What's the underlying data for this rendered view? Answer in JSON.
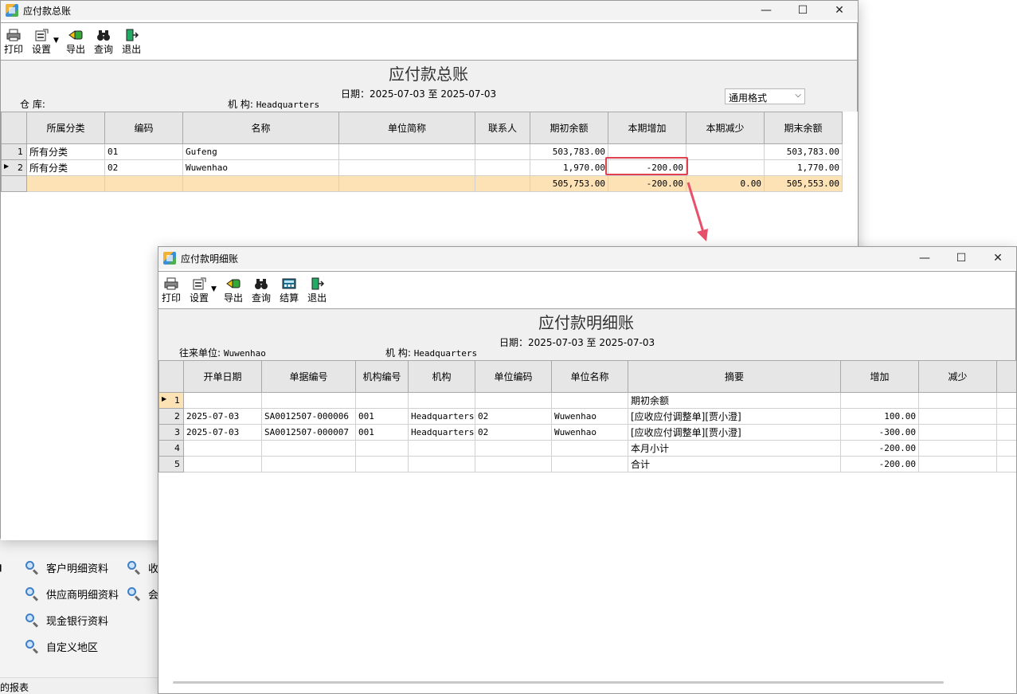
{
  "bg_links": [
    {
      "label": "客户明细资料"
    },
    {
      "label": "供应商明细资料"
    },
    {
      "label": "现金银行资料"
    },
    {
      "label": "自定义地区"
    }
  ],
  "bg_partial": [
    "收",
    "会"
  ],
  "bg_left_partial": "的报表",
  "win1": {
    "title": "应付款总账",
    "toolbar": {
      "print": "打印",
      "settings": "设置",
      "export": "导出",
      "query": "查询",
      "exit": "退出"
    },
    "report_title": "应付款总账",
    "date_label": "日期：2025-07-03  至  2025-07-03",
    "warehouse_label": "仓    库:",
    "org_label": "机    构:",
    "org_value": "Headquarters",
    "format_select": "通用格式",
    "columns": [
      "所属分类",
      "编码",
      "名称",
      "单位简称",
      "联系人",
      "期初余额",
      "本期增加",
      "本期减少",
      "期末余额"
    ],
    "rows": [
      {
        "no": "1",
        "cells": [
          "所有分类",
          "01",
          "Gufeng",
          "",
          "",
          "503,783.00",
          "",
          "",
          "503,783.00"
        ]
      },
      {
        "no": "2",
        "cells": [
          "所有分类",
          "02",
          "Wuwenhao",
          "",
          "",
          "1,970.00",
          "-200.00",
          "",
          "1,770.00"
        ]
      }
    ],
    "total": [
      "",
      "",
      "",
      "",
      "",
      "505,753.00",
      "-200.00",
      "0.00",
      "505,553.00"
    ]
  },
  "win2": {
    "title": "应付款明细账",
    "toolbar": {
      "print": "打印",
      "settings": "设置",
      "export": "导出",
      "query": "查询",
      "settle": "结算",
      "exit": "退出"
    },
    "report_title": "应付款明细账",
    "date_label": "日期：2025-07-03  至  2025-07-03",
    "partner_label": "往来单位:",
    "partner_value": "Wuwenhao",
    "org_label": "机    构:",
    "org_value": "Headquarters",
    "columns": [
      "开单日期",
      "单据编号",
      "机构编号",
      "机构",
      "单位编码",
      "单位名称",
      "摘要",
      "增加",
      "减少"
    ],
    "rows": [
      {
        "no": "1",
        "cells": [
          "",
          "",
          "",
          "",
          "",
          "",
          "期初余额",
          "",
          ""
        ]
      },
      {
        "no": "2",
        "cells": [
          "2025-07-03",
          "SA0012507-000006",
          "001",
          "Headquarters",
          "02",
          "Wuwenhao",
          "[应收应付调整单][贾小澄]",
          "100.00",
          ""
        ]
      },
      {
        "no": "3",
        "cells": [
          "2025-07-03",
          "SA0012507-000007",
          "001",
          "Headquarters",
          "02",
          "Wuwenhao",
          "[应收应付调整单][贾小澄]",
          "-300.00",
          ""
        ]
      },
      {
        "no": "4",
        "cells": [
          "",
          "",
          "",
          "",
          "",
          "",
          "本月小计",
          "-200.00",
          ""
        ]
      },
      {
        "no": "5",
        "cells": [
          "",
          "",
          "",
          "",
          "",
          "",
          "合计",
          "-200.00",
          ""
        ]
      }
    ]
  },
  "colors": {
    "highlight_border": "#e04050",
    "total_row": "#fde2b5",
    "arrow": "#e8506a"
  }
}
